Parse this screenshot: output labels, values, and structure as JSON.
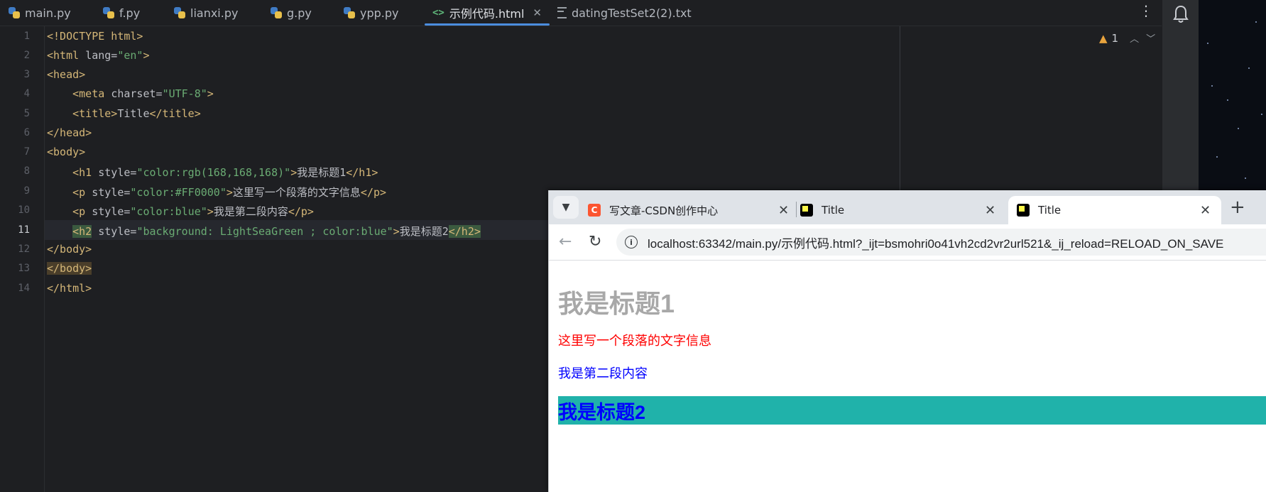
{
  "editor": {
    "tabs": [
      {
        "label": "main.py",
        "icon": "python-icon"
      },
      {
        "label": "f.py",
        "icon": "python-icon"
      },
      {
        "label": "lianxi.py",
        "icon": "python-icon"
      },
      {
        "label": "g.py",
        "icon": "python-icon"
      },
      {
        "label": "ypp.py",
        "icon": "python-icon"
      },
      {
        "label": "示例代码.html",
        "icon": "html-icon",
        "active": true
      },
      {
        "label": "datingTestSet2(2).txt",
        "icon": "text-file-icon"
      }
    ],
    "inspection_count": "1",
    "current_line": 11,
    "line_numbers": [
      "1",
      "2",
      "3",
      "4",
      "5",
      "6",
      "7",
      "8",
      "9",
      "10",
      "11",
      "12",
      "13",
      "14"
    ],
    "lines": {
      "l1": "<!DOCTYPE html>",
      "l2_open": "<html ",
      "l2_attr": "lang=",
      "l2_val": "\"en\"",
      "l2_close": ">",
      "l3": "<head>",
      "l4_open": "    <meta ",
      "l4_attr": "charset=",
      "l4_val": "\"UTF-8\"",
      "l4_close": ">",
      "l5_open": "    <title>",
      "l5_text": "Title",
      "l5_close": "</title>",
      "l6": "</head>",
      "l7": "<body>",
      "l8_open": "    <h1 ",
      "l8_attr": "style=",
      "l8_val": "\"color:rgb(168,168,168)\"",
      "l8_gt": ">",
      "l8_text": "我是标题1",
      "l8_close": "</h1>",
      "l9_open": "    <p ",
      "l9_attr": "style=",
      "l9_val": "\"color:#FF0000\"",
      "l9_gt": ">",
      "l9_text": "这里写一个段落的文字信息",
      "l9_close": "</p>",
      "l10_open": "    <p ",
      "l10_attr": "style=",
      "l10_val": "\"color:blue\"",
      "l10_gt": ">",
      "l10_text": "我是第二段内容",
      "l10_close": "</p>",
      "l11_indent": "    ",
      "l11_open": "<h2",
      "l11_attr": " style=",
      "l11_val": "\"background: LightSeaGreen ; color:blue\"",
      "l11_gt": ">",
      "l11_text": "我是标题2",
      "l11_close": "</h2>",
      "l12": "</body>",
      "l13": "</body>",
      "l14": "</html>"
    }
  },
  "browser": {
    "tabs": [
      {
        "label": "写文章-CSDN创作中心",
        "favicon": "csdn-icon"
      },
      {
        "label": "Title",
        "favicon": "pycharm-icon"
      },
      {
        "label": "Title",
        "favicon": "pycharm-icon",
        "active": true
      }
    ],
    "url": "localhost:63342/main.py/示例代码.html?_ijt=bsmohri0o41vh2cd2vr2url521&_ij_reload=RELOAD_ON_SAVE",
    "page": {
      "h1": "我是标题1",
      "p1": "这里写一个段落的文字信息",
      "p2": "我是第二段内容",
      "h2": "我是标题2"
    }
  },
  "colors": {
    "ide_bg": "#1e1f22",
    "accent": "#4b8dde",
    "tag": "#d5b778",
    "string": "#6aab73",
    "h1_color": "rgb(168,168,168)",
    "p1_color": "#FF0000",
    "p2_color": "blue",
    "h2_bg": "LightSeaGreen"
  }
}
